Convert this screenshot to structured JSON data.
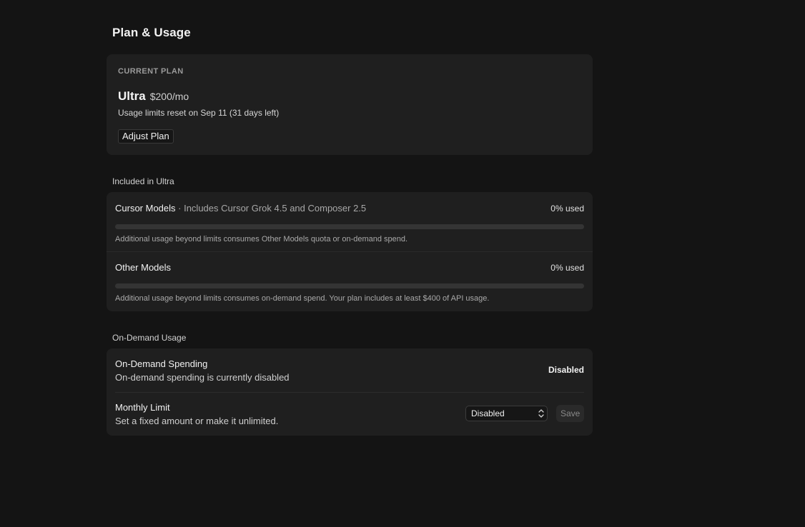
{
  "page": {
    "title": "Plan & Usage"
  },
  "current_plan": {
    "label": "CURRENT PLAN",
    "name": "Ultra",
    "price": "$200/mo",
    "reset_text": "Usage limits reset on Sep 11 (31 days left)",
    "adjust_button": "Adjust Plan"
  },
  "included": {
    "section_label": "Included in Ultra",
    "items": [
      {
        "title": "Cursor Models",
        "subtitle": " · Includes Cursor Grok 4.5 and Composer 2.5",
        "usage": "0% used",
        "usage_fraction": 0,
        "note": "Additional usage beyond limits consumes Other Models quota or on-demand spend."
      },
      {
        "title": "Other Models",
        "subtitle": "",
        "usage": "0% used",
        "usage_fraction": 0,
        "note": "Additional usage beyond limits consumes on-demand spend. Your plan includes at least $400 of API usage."
      }
    ]
  },
  "on_demand": {
    "section_label": "On-Demand Usage",
    "spending": {
      "title": "On-Demand Spending",
      "description": "On-demand spending is currently disabled",
      "status": "Disabled"
    },
    "monthly_limit": {
      "title": "Monthly Limit",
      "description": "Set a fixed amount or make it unlimited.",
      "selected": "Disabled",
      "save_button": "Save"
    }
  },
  "icons": {
    "select_chevron": "chevron-up-down-icon"
  }
}
